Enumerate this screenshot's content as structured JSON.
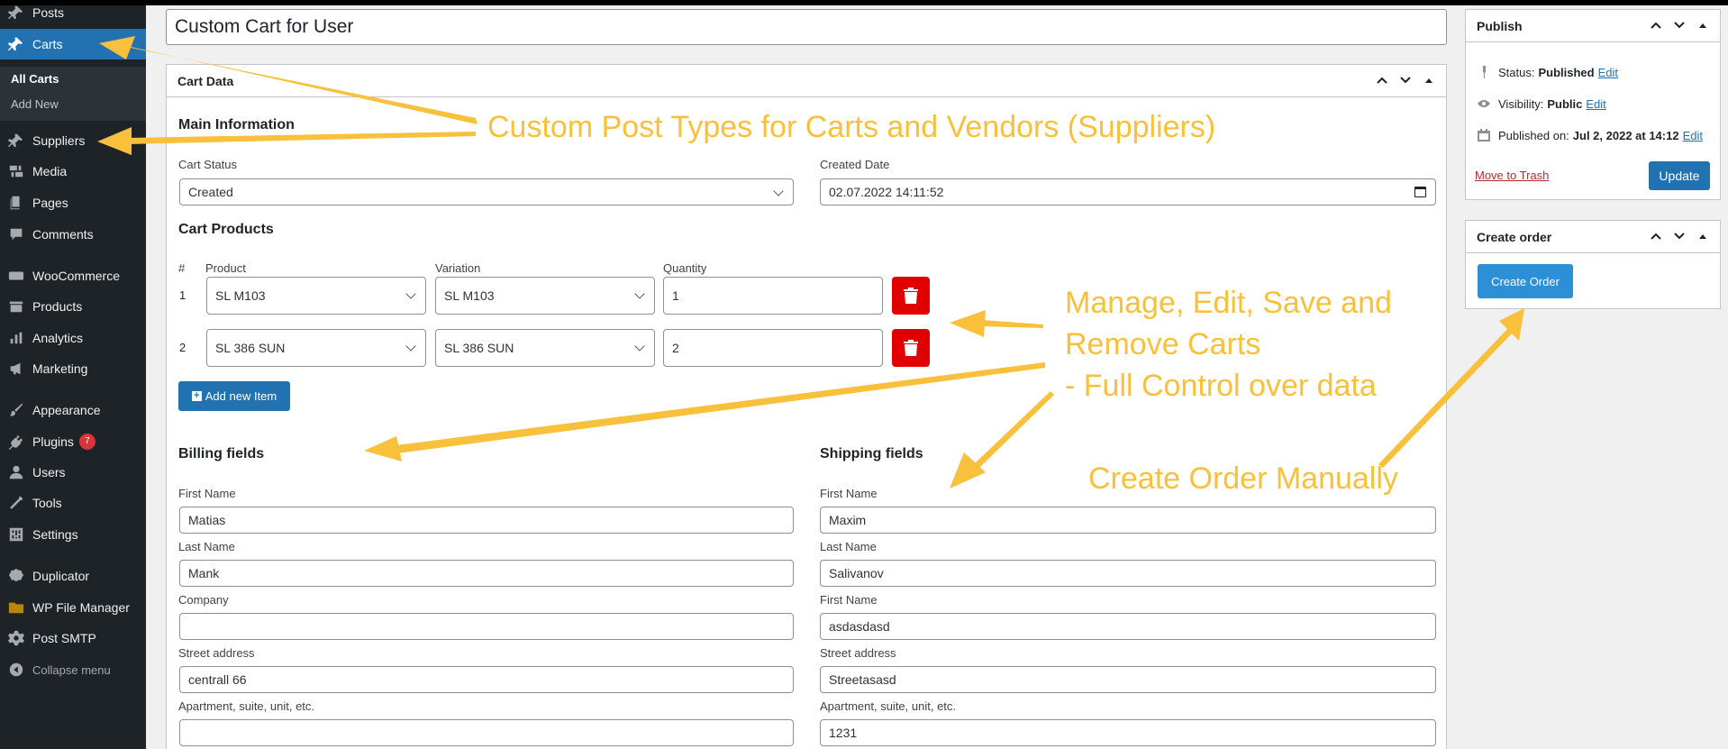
{
  "sidebar": {
    "items": [
      {
        "label": "Posts",
        "icon": "pin-icon"
      },
      {
        "label": "Carts",
        "icon": "pin-icon"
      },
      {
        "label": "Suppliers",
        "icon": "pin-icon"
      },
      {
        "label": "Media",
        "icon": "media-icon"
      },
      {
        "label": "Pages",
        "icon": "pages-icon"
      },
      {
        "label": "Comments",
        "icon": "comments-icon"
      },
      {
        "label": "WooCommerce",
        "icon": "woo-icon"
      },
      {
        "label": "Products",
        "icon": "products-icon"
      },
      {
        "label": "Analytics",
        "icon": "analytics-icon"
      },
      {
        "label": "Marketing",
        "icon": "megaphone-icon"
      },
      {
        "label": "Appearance",
        "icon": "brush-icon"
      },
      {
        "label": "Plugins",
        "icon": "plug-icon",
        "badge": "7"
      },
      {
        "label": "Users",
        "icon": "user-icon"
      },
      {
        "label": "Tools",
        "icon": "wrench-icon"
      },
      {
        "label": "Settings",
        "icon": "settings-icon"
      },
      {
        "label": "Duplicator",
        "icon": "duplicator-icon"
      },
      {
        "label": "WP File Manager",
        "icon": "folder-icon"
      },
      {
        "label": "Post SMTP",
        "icon": "gear-icon"
      }
    ],
    "submenu": [
      "All Carts",
      "Add New"
    ],
    "collapse": "Collapse menu"
  },
  "post_title": "Custom Cart for User",
  "cart_box": {
    "title": "Cart Data",
    "main_info": "Main Information",
    "cart_status_label": "Cart Status",
    "cart_status": "Created",
    "created_date_label": "Created Date",
    "created_date": "02.07.2022 14:11:52",
    "products_title": "Cart Products",
    "headers": {
      "num": "#",
      "product": "Product",
      "variation": "Variation",
      "quantity": "Quantity"
    },
    "rows": [
      {
        "num": "1",
        "product": "SL M103",
        "variation": "SL M103",
        "quantity": "1"
      },
      {
        "num": "2",
        "product": "SL 386 SUN",
        "variation": "SL 386 SUN",
        "quantity": "2"
      }
    ],
    "add_item": "Add new Item",
    "billing": {
      "title": "Billing fields",
      "fields": [
        {
          "label": "First Name",
          "value": "Matias"
        },
        {
          "label": "Last Name",
          "value": "Mank"
        },
        {
          "label": "Company",
          "value": ""
        },
        {
          "label": "Street address",
          "value": "centrall 66"
        },
        {
          "label": "Apartment, suite, unit, etc.",
          "value": ""
        }
      ]
    },
    "shipping": {
      "title": "Shipping fields",
      "fields": [
        {
          "label": "First Name",
          "value": "Maxim"
        },
        {
          "label": "Last Name",
          "value": "Salivanov"
        },
        {
          "label": "First Name",
          "value": "asdasdasd"
        },
        {
          "label": "Street address",
          "value": "Streetasasd"
        },
        {
          "label": "Apartment, suite, unit, etc.",
          "value": "1231"
        }
      ]
    }
  },
  "publish": {
    "title": "Publish",
    "status_label": "Status:",
    "status": "Published",
    "visibility_label": "Visibility:",
    "visibility": "Public",
    "published_label": "Published on:",
    "published": "Jul 2, 2022 at 14:12",
    "edit": "Edit",
    "trash": "Move to Trash",
    "update": "Update"
  },
  "create_order_box": {
    "title": "Create order",
    "button": "Create Order"
  },
  "annotations": {
    "cpt": "Custom Post Types for Carts and Vendors (Suppliers)",
    "manage1": "Manage, Edit, Save and",
    "manage2": "Remove Carts",
    "manage3": "- Full Control over data",
    "create": "Create Order Manually"
  },
  "colors": {
    "accent": "#2271b1",
    "annotation": "#f8c03b",
    "delete": "#e00000",
    "sidebar": "#1d2327"
  }
}
